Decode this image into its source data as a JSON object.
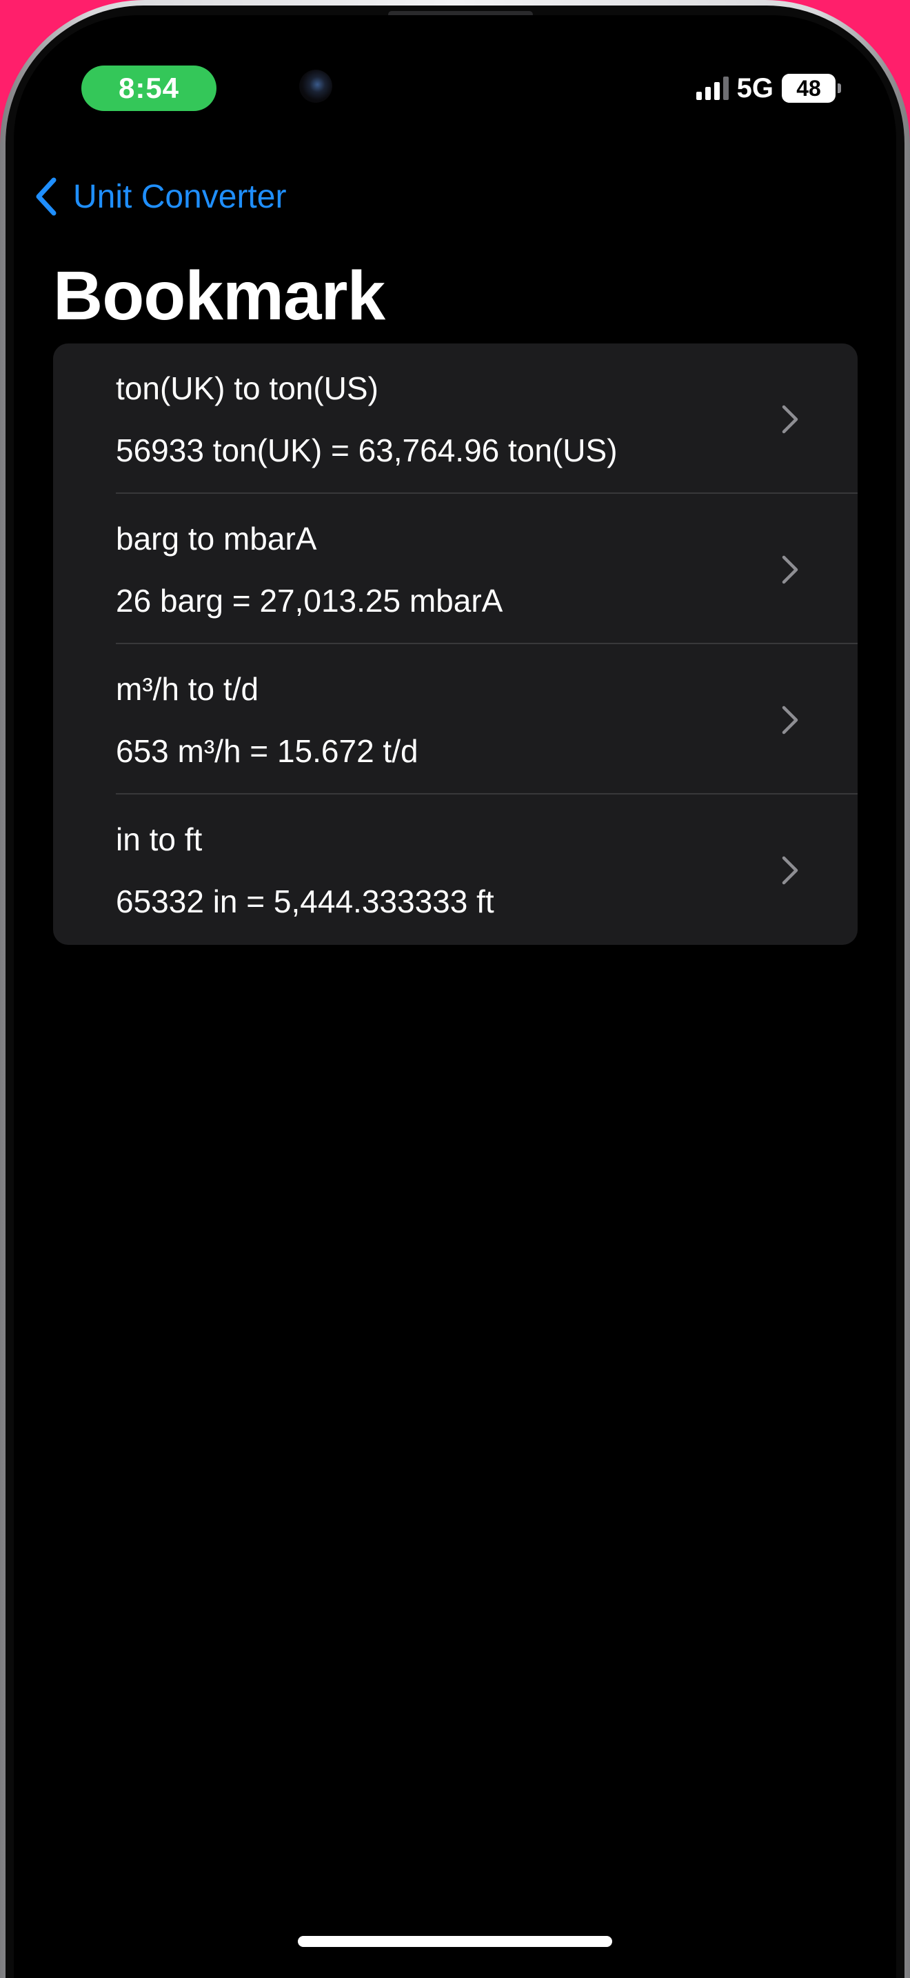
{
  "status_bar": {
    "time": "8:54",
    "network": "5G",
    "battery": "48"
  },
  "navigation": {
    "back_label": "Unit Converter"
  },
  "page": {
    "title": "Bookmark"
  },
  "bookmarks": [
    {
      "title": "ton(UK) to ton(US)",
      "result": "56933 ton(UK) = 63,764.96 ton(US)"
    },
    {
      "title": "barg to mbarA",
      "result": "26 barg = 27,013.25 mbarA"
    },
    {
      "title": "m³/h to t/d",
      "result": "653 m³/h = 15.672 t/d"
    },
    {
      "title": "in to ft",
      "result": "65332 in = 5,444.333333 ft"
    }
  ],
  "colors": {
    "accent": "#1f8fff",
    "time_pill": "#34c759",
    "list_background": "#1c1c1e",
    "background": "#000000"
  },
  "icons": {
    "back": "chevron-left-icon",
    "row": "chevron-right-icon",
    "signal": "cellular-signal-icon",
    "battery": "battery-icon"
  }
}
